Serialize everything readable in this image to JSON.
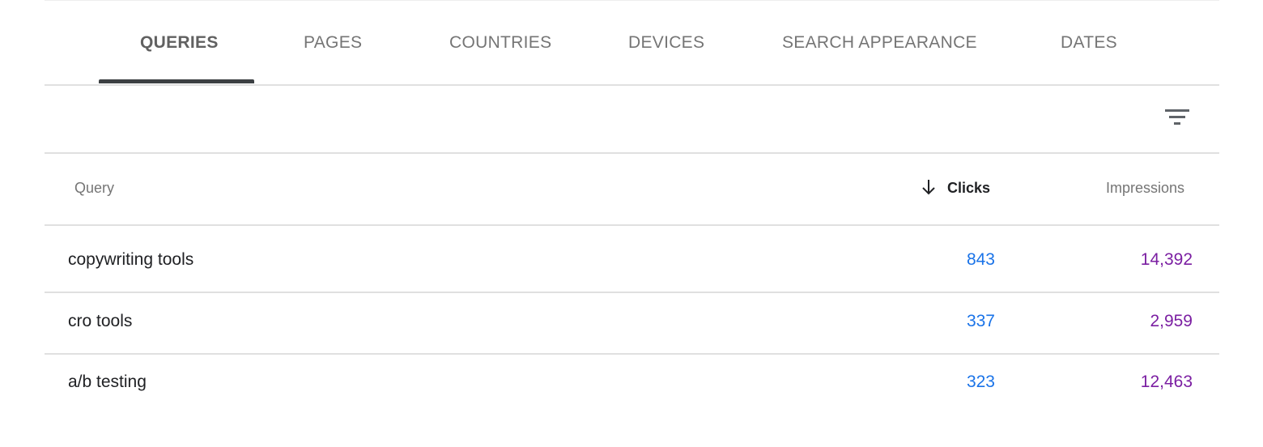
{
  "tabs": [
    {
      "label": "QUERIES",
      "active": true
    },
    {
      "label": "PAGES",
      "active": false
    },
    {
      "label": "COUNTRIES",
      "active": false
    },
    {
      "label": "DEVICES",
      "active": false
    },
    {
      "label": "SEARCH APPEARANCE",
      "active": false
    },
    {
      "label": "DATES",
      "active": false
    }
  ],
  "toolbar": {
    "filter_icon": "filter-list-icon"
  },
  "table": {
    "headers": {
      "query": "Query",
      "clicks": "Clicks",
      "impressions": "Impressions"
    },
    "sort": {
      "column": "clicks",
      "direction": "descending",
      "icon": "arrow-down-icon"
    },
    "rows": [
      {
        "query": "copywriting tools",
        "clicks": "843",
        "impressions": "14,392"
      },
      {
        "query": "cro tools",
        "clicks": "337",
        "impressions": "2,959"
      },
      {
        "query": "a/b testing",
        "clicks": "323",
        "impressions": "12,463"
      }
    ]
  },
  "colors": {
    "clicks": "#1a73e8",
    "impressions": "#7b1fa2",
    "tab_indicator": "#3c4043",
    "divider": "#e0e0e0"
  }
}
